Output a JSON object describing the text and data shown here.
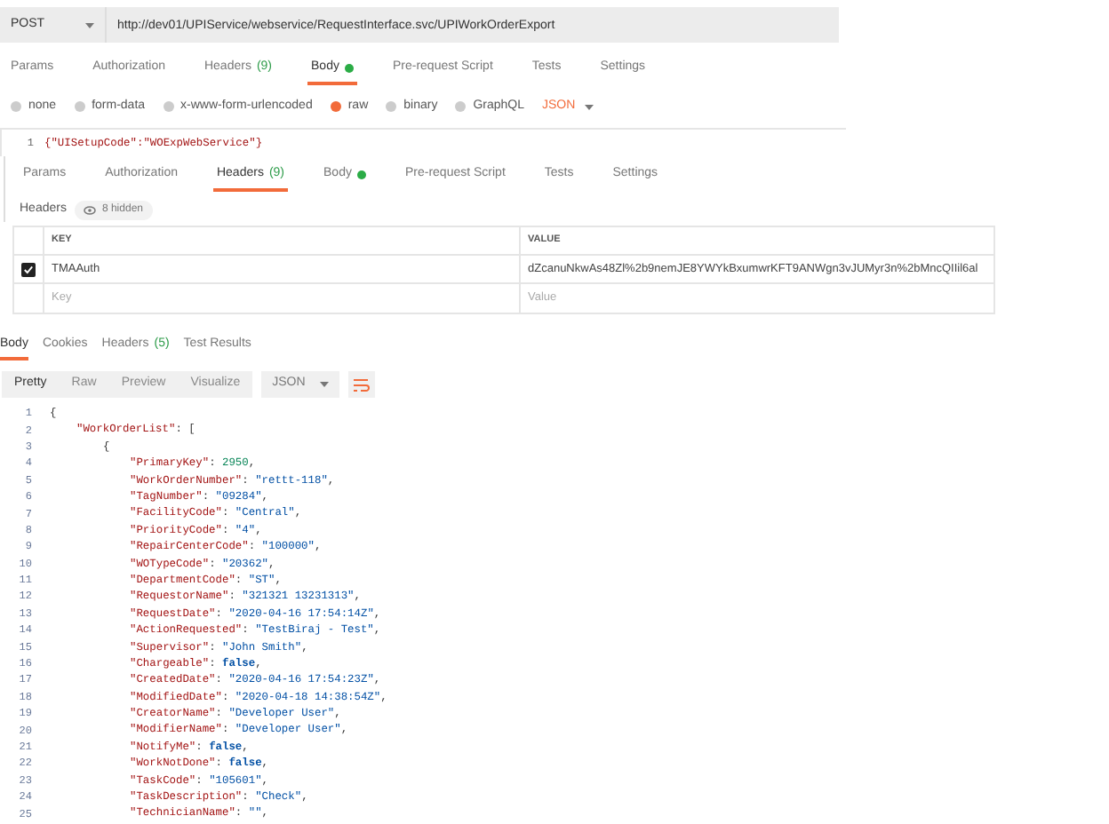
{
  "request": {
    "method": "POST",
    "url": "http://dev01/UPIService/webservice/RequestInterface.svc/UPIWorkOrderExport"
  },
  "request_tabs": [
    {
      "label": "Params",
      "selected": false
    },
    {
      "label": "Authorization",
      "selected": false
    },
    {
      "label": "Headers",
      "count": "(9)",
      "selected": false
    },
    {
      "label": "Body",
      "dot": true,
      "selected": true
    },
    {
      "label": "Pre-request Script",
      "selected": false
    },
    {
      "label": "Tests",
      "selected": false
    },
    {
      "label": "Settings",
      "selected": false
    }
  ],
  "body_types": [
    {
      "label": "none",
      "selected": false
    },
    {
      "label": "form-data",
      "selected": false
    },
    {
      "label": "x-www-form-urlencoded",
      "selected": false
    },
    {
      "label": "raw",
      "selected": true
    },
    {
      "label": "binary",
      "selected": false
    },
    {
      "label": "GraphQL",
      "selected": false
    }
  ],
  "body_format": "JSON",
  "body_editor": [
    {
      "number": "1",
      "text": "{\"UISetupCode\":\"WOExpWebService\"}"
    }
  ],
  "second_tabs": [
    {
      "label": "Params",
      "selected": false
    },
    {
      "label": "Authorization",
      "selected": false
    },
    {
      "label": "Headers",
      "count": "(9)",
      "selected": true
    },
    {
      "label": "Body",
      "dot": true,
      "selected": false
    },
    {
      "label": "Pre-request Script",
      "selected": false
    },
    {
      "label": "Tests",
      "selected": false
    },
    {
      "label": "Settings",
      "selected": false
    }
  ],
  "headers": {
    "title": "Headers",
    "hidden": "8 hidden",
    "columns": [
      "KEY",
      "VALUE"
    ],
    "rows": [
      {
        "key": "TMAAuth",
        "value": "dZcanuNkwAs48Zl%2b9nemJE8YWYkBxumwrKFT9ANWgn3vJUMyr3n%2bMncQIIil6al",
        "checked": true
      }
    ],
    "placeholder_key": "Key",
    "placeholder_value": "Value"
  },
  "response_tabs": [
    {
      "label": "Body",
      "selected": true
    },
    {
      "label": "Cookies",
      "selected": false
    },
    {
      "label": "Headers",
      "count": "(5)",
      "selected": false
    },
    {
      "label": "Test Results",
      "selected": false
    }
  ],
  "view_modes": [
    {
      "label": "Pretty",
      "selected": true
    },
    {
      "label": "Raw",
      "selected": false
    },
    {
      "label": "Preview",
      "selected": false
    },
    {
      "label": "Visualize",
      "selected": false
    }
  ],
  "response_format": "JSON",
  "response_lines": [
    {
      "number": "1",
      "parts": [
        {
          "kind": "punct",
          "text": "{"
        }
      ],
      "children": [
        {
          "number": "2",
          "parts": [
            {
              "kind": "key",
              "text": "\"WorkOrderList\""
            },
            {
              "kind": "punct",
              "text": ": ["
            }
          ],
          "children": [
            {
              "number": "3",
              "parts": [
                {
                  "kind": "punct",
                  "text": "{"
                }
              ],
              "children": [
                {
                  "number": "4",
                  "parts": [
                    {
                      "kind": "key",
                      "text": "\"PrimaryKey\""
                    },
                    {
                      "kind": "punct",
                      "text": ": "
                    },
                    {
                      "kind": "number",
                      "text": "2950"
                    },
                    {
                      "kind": "punct",
                      "text": ","
                    }
                  ]
                },
                {
                  "number": "5",
                  "parts": [
                    {
                      "kind": "key",
                      "text": "\"WorkOrderNumber\""
                    },
                    {
                      "kind": "punct",
                      "text": ": "
                    },
                    {
                      "kind": "string",
                      "text": "\"rettt-118\""
                    },
                    {
                      "kind": "punct",
                      "text": ","
                    }
                  ]
                },
                {
                  "number": "6",
                  "parts": [
                    {
                      "kind": "key",
                      "text": "\"TagNumber\""
                    },
                    {
                      "kind": "punct",
                      "text": ": "
                    },
                    {
                      "kind": "string",
                      "text": "\"09284\""
                    },
                    {
                      "kind": "punct",
                      "text": ","
                    }
                  ]
                },
                {
                  "number": "7",
                  "parts": [
                    {
                      "kind": "key",
                      "text": "\"FacilityCode\""
                    },
                    {
                      "kind": "punct",
                      "text": ": "
                    },
                    {
                      "kind": "string",
                      "text": "\"Central\""
                    },
                    {
                      "kind": "punct",
                      "text": ","
                    }
                  ]
                },
                {
                  "number": "8",
                  "parts": [
                    {
                      "kind": "key",
                      "text": "\"PriorityCode\""
                    },
                    {
                      "kind": "punct",
                      "text": ": "
                    },
                    {
                      "kind": "string",
                      "text": "\"4\""
                    },
                    {
                      "kind": "punct",
                      "text": ","
                    }
                  ]
                },
                {
                  "number": "9",
                  "parts": [
                    {
                      "kind": "key",
                      "text": "\"RepairCenterCode\""
                    },
                    {
                      "kind": "punct",
                      "text": ": "
                    },
                    {
                      "kind": "string",
                      "text": "\"100000\""
                    },
                    {
                      "kind": "punct",
                      "text": ","
                    }
                  ]
                },
                {
                  "number": "10",
                  "parts": [
                    {
                      "kind": "key",
                      "text": "\"WOTypeCode\""
                    },
                    {
                      "kind": "punct",
                      "text": ": "
                    },
                    {
                      "kind": "string",
                      "text": "\"20362\""
                    },
                    {
                      "kind": "punct",
                      "text": ","
                    }
                  ]
                },
                {
                  "number": "11",
                  "parts": [
                    {
                      "kind": "key",
                      "text": "\"DepartmentCode\""
                    },
                    {
                      "kind": "punct",
                      "text": ": "
                    },
                    {
                      "kind": "string",
                      "text": "\"ST\""
                    },
                    {
                      "kind": "punct",
                      "text": ","
                    }
                  ]
                },
                {
                  "number": "12",
                  "parts": [
                    {
                      "kind": "key",
                      "text": "\"RequestorName\""
                    },
                    {
                      "kind": "punct",
                      "text": ": "
                    },
                    {
                      "kind": "string",
                      "text": "\"321321 13231313\""
                    },
                    {
                      "kind": "punct",
                      "text": ","
                    }
                  ]
                },
                {
                  "number": "13",
                  "parts": [
                    {
                      "kind": "key",
                      "text": "\"RequestDate\""
                    },
                    {
                      "kind": "punct",
                      "text": ": "
                    },
                    {
                      "kind": "string",
                      "text": "\"2020-04-16 17:54:14Z\""
                    },
                    {
                      "kind": "punct",
                      "text": ","
                    }
                  ]
                },
                {
                  "number": "14",
                  "parts": [
                    {
                      "kind": "key",
                      "text": "\"ActionRequested\""
                    },
                    {
                      "kind": "punct",
                      "text": ": "
                    },
                    {
                      "kind": "string",
                      "text": "\"TestBiraj - Test\""
                    },
                    {
                      "kind": "punct",
                      "text": ","
                    }
                  ]
                },
                {
                  "number": "15",
                  "parts": [
                    {
                      "kind": "key",
                      "text": "\"Supervisor\""
                    },
                    {
                      "kind": "punct",
                      "text": ": "
                    },
                    {
                      "kind": "string",
                      "text": "\"John Smith\""
                    },
                    {
                      "kind": "punct",
                      "text": ","
                    }
                  ]
                },
                {
                  "number": "16",
                  "parts": [
                    {
                      "kind": "key",
                      "text": "\"Chargeable\""
                    },
                    {
                      "kind": "punct",
                      "text": ": "
                    },
                    {
                      "kind": "bool",
                      "text": "false"
                    },
                    {
                      "kind": "punct",
                      "text": ","
                    }
                  ]
                },
                {
                  "number": "17",
                  "parts": [
                    {
                      "kind": "key",
                      "text": "\"CreatedDate\""
                    },
                    {
                      "kind": "punct",
                      "text": ": "
                    },
                    {
                      "kind": "string",
                      "text": "\"2020-04-16 17:54:23Z\""
                    },
                    {
                      "kind": "punct",
                      "text": ","
                    }
                  ]
                },
                {
                  "number": "18",
                  "parts": [
                    {
                      "kind": "key",
                      "text": "\"ModifiedDate\""
                    },
                    {
                      "kind": "punct",
                      "text": ": "
                    },
                    {
                      "kind": "string",
                      "text": "\"2020-04-18 14:38:54Z\""
                    },
                    {
                      "kind": "punct",
                      "text": ","
                    }
                  ]
                },
                {
                  "number": "19",
                  "parts": [
                    {
                      "kind": "key",
                      "text": "\"CreatorName\""
                    },
                    {
                      "kind": "punct",
                      "text": ": "
                    },
                    {
                      "kind": "string",
                      "text": "\"Developer User\""
                    },
                    {
                      "kind": "punct",
                      "text": ","
                    }
                  ]
                },
                {
                  "number": "20",
                  "parts": [
                    {
                      "kind": "key",
                      "text": "\"ModifierName\""
                    },
                    {
                      "kind": "punct",
                      "text": ": "
                    },
                    {
                      "kind": "string",
                      "text": "\"Developer User\""
                    },
                    {
                      "kind": "punct",
                      "text": ","
                    }
                  ]
                },
                {
                  "number": "21",
                  "parts": [
                    {
                      "kind": "key",
                      "text": "\"NotifyMe\""
                    },
                    {
                      "kind": "punct",
                      "text": ": "
                    },
                    {
                      "kind": "bool",
                      "text": "false"
                    },
                    {
                      "kind": "punct",
                      "text": ","
                    }
                  ]
                },
                {
                  "number": "22",
                  "parts": [
                    {
                      "kind": "key",
                      "text": "\"WorkNotDone\""
                    },
                    {
                      "kind": "punct",
                      "text": ": "
                    },
                    {
                      "kind": "bool",
                      "text": "false"
                    },
                    {
                      "kind": "punct",
                      "text": ","
                    }
                  ]
                },
                {
                  "number": "23",
                  "parts": [
                    {
                      "kind": "key",
                      "text": "\"TaskCode\""
                    },
                    {
                      "kind": "punct",
                      "text": ": "
                    },
                    {
                      "kind": "string",
                      "text": "\"105601\""
                    },
                    {
                      "kind": "punct",
                      "text": ","
                    }
                  ]
                },
                {
                  "number": "24",
                  "parts": [
                    {
                      "kind": "key",
                      "text": "\"TaskDescription\""
                    },
                    {
                      "kind": "punct",
                      "text": ": "
                    },
                    {
                      "kind": "string",
                      "text": "\"Check\""
                    },
                    {
                      "kind": "punct",
                      "text": ","
                    }
                  ]
                },
                {
                  "number": "25",
                  "parts": [
                    {
                      "kind": "key",
                      "text": "\"TechnicianName\""
                    },
                    {
                      "kind": "punct",
                      "text": ": "
                    },
                    {
                      "kind": "string",
                      "text": "\"\""
                    },
                    {
                      "kind": "punct",
                      "text": ","
                    }
                  ]
                }
              ]
            }
          ]
        }
      ]
    }
  ]
}
